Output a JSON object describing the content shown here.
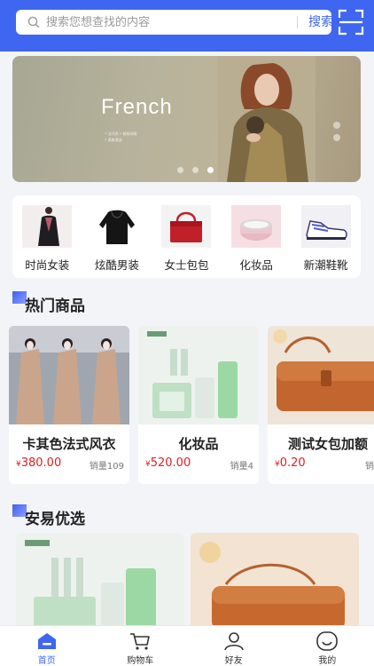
{
  "search": {
    "placeholder": "搜索您想查找的内容",
    "button_label": "搜索"
  },
  "banner": {
    "title": "French",
    "subtitle_lines": [
      "• 法式风 • 精致闲暇",
      "• 满美潮流"
    ],
    "page_count": 3,
    "active_page": 3
  },
  "categories": [
    {
      "label": "时尚女装",
      "icon": "women-coat-icon"
    },
    {
      "label": "炫酷男装",
      "icon": "hoodie-icon"
    },
    {
      "label": "女士包包",
      "icon": "handbag-icon"
    },
    {
      "label": "化妆品",
      "icon": "cosmetics-icon"
    },
    {
      "label": "新潮鞋靴",
      "icon": "sneaker-icon"
    }
  ],
  "hot": {
    "title": "热门商品",
    "products": [
      {
        "name": "卡其色法式风衣",
        "currency": "¥",
        "price": "380.00",
        "sales": "销量109"
      },
      {
        "name": "化妆品",
        "currency": "¥",
        "price": "520.00",
        "sales": "销量4"
      },
      {
        "name": "测试女包加额",
        "currency": "¥",
        "price": "0.20",
        "sales": "销量"
      }
    ]
  },
  "picks": {
    "title": "安易优选"
  },
  "tabbar": [
    {
      "label": "首页",
      "active": true
    },
    {
      "label": "购物车",
      "active": false
    },
    {
      "label": "好友",
      "active": false
    },
    {
      "label": "我的",
      "active": false
    }
  ],
  "colors": {
    "primary": "#3f66f0",
    "price": "#e02020",
    "background": "#f3f4f8"
  }
}
